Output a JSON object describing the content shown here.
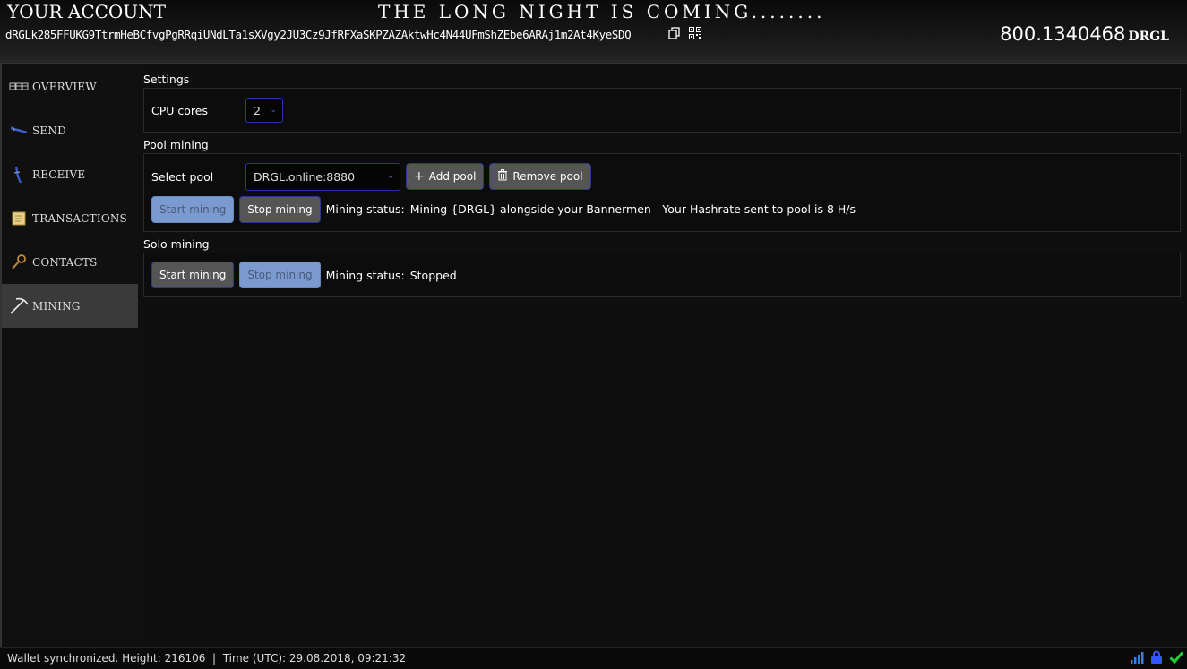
{
  "header": {
    "account_title": "YOUR ACCOUNT",
    "tagline": "THE LONG NIGHT IS COMING........",
    "address": "dRGLk285FFUKG9TtrmHeBCfvgPgRRqiUNdLTa1sXVgy2JU3Cz9JfRFXaSKPZAZAktwHc4N44UFmShZEbe6ARAj1m2At4KyeSDQ",
    "balance": "800.1340468",
    "balance_unit": "DRGL",
    "icons": [
      "copy-icon",
      "qr-code-icon"
    ]
  },
  "sidebar": {
    "items": [
      {
        "label": "OVERVIEW",
        "icon": "overview-icon",
        "active": false
      },
      {
        "label": "SEND",
        "icon": "send-icon",
        "active": false
      },
      {
        "label": "RECEIVE",
        "icon": "receive-icon",
        "active": false
      },
      {
        "label": "TRANSACTIONS",
        "icon": "transactions-icon",
        "active": false
      },
      {
        "label": "CONTACTS",
        "icon": "contacts-icon",
        "active": false
      },
      {
        "label": "MINING",
        "icon": "mining-icon",
        "active": true
      }
    ]
  },
  "settings": {
    "title": "Settings",
    "cpu_label": "CPU cores",
    "cpu_value": "2"
  },
  "pool": {
    "title": "Pool mining",
    "select_label": "Select pool",
    "selected_pool": "DRGL.online:8880",
    "add_label": "Add pool",
    "remove_label": "Remove pool",
    "start_label": "Start mining",
    "stop_label": "Stop mining",
    "status_label": "Mining status:",
    "status_value": "Mining {DRGL} alongside your Bannermen - Your Hashrate sent to pool is 8 H/s"
  },
  "solo": {
    "title": "Solo mining",
    "start_label": "Start mining",
    "stop_label": "Stop mining",
    "status_label": "Mining status:",
    "status_value": "Stopped"
  },
  "footer": {
    "status_text": "Wallet synchronized. Height: 216106  |  Time (UTC): 29.08.2018, 09:21:32",
    "icons": [
      "signal-icon",
      "lock-icon",
      "checkmark-icon"
    ]
  },
  "colors": {
    "accent_border": "#2233aa",
    "disabled_button": "#7a9ad0",
    "ok_green": "#22cc33",
    "lock_blue": "#3355ff"
  }
}
